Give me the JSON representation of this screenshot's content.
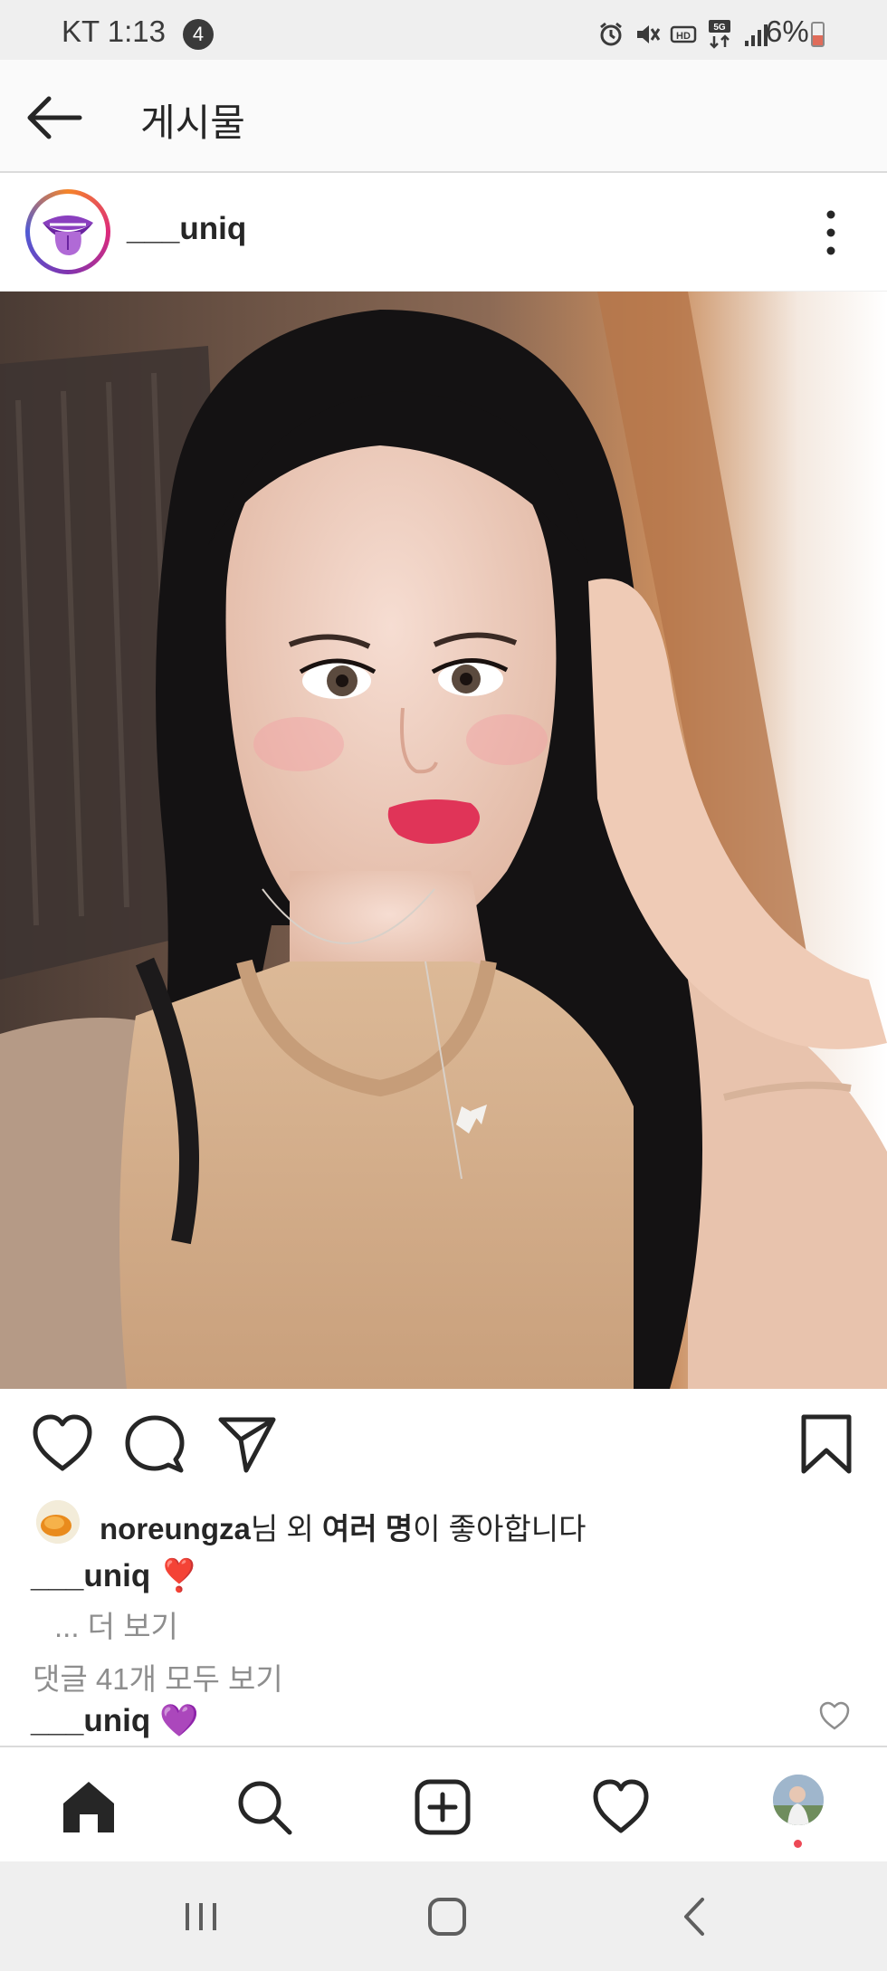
{
  "status_bar": {
    "carrier_time": "KT 1:13",
    "notification_count": "4",
    "battery": "6%",
    "icons": [
      "alarm-icon",
      "mute-icon",
      "hd-icon",
      "5g-icon",
      "signal-icon",
      "battery-icon"
    ],
    "battery_level_fraction": 0.06
  },
  "header": {
    "title": "게시물",
    "back_icon": "arrow-left-icon"
  },
  "post": {
    "username": "___uniq",
    "avatar_icon": "lips-tongue-logo",
    "more_icon": "vertical-dots-icon",
    "image": "selfie-photo"
  },
  "actions": {
    "like_icon": "heart-outline-icon",
    "comment_icon": "comment-bubble-icon",
    "share_icon": "paper-plane-icon",
    "save_icon": "bookmark-icon"
  },
  "likes": {
    "user": "noreungza",
    "suffix1": "님 외 ",
    "many": "여러 명",
    "suffix2": "이 좋아합니다"
  },
  "caption": {
    "username": "___uniq",
    "emoji": "❣️",
    "more_label": "... 더 보기"
  },
  "comments": {
    "view_all": "댓글 41개 모두 보기",
    "items": [
      {
        "username": "___uniq",
        "text": "💜"
      }
    ]
  },
  "bottom_nav": {
    "items": [
      "home-icon",
      "search-icon",
      "add-post-icon",
      "activity-heart-icon",
      "profile-avatar"
    ],
    "accent": "#ed4956"
  },
  "system_nav": {
    "items": [
      "recent-apps-icon",
      "home-button-icon",
      "back-icon"
    ]
  }
}
